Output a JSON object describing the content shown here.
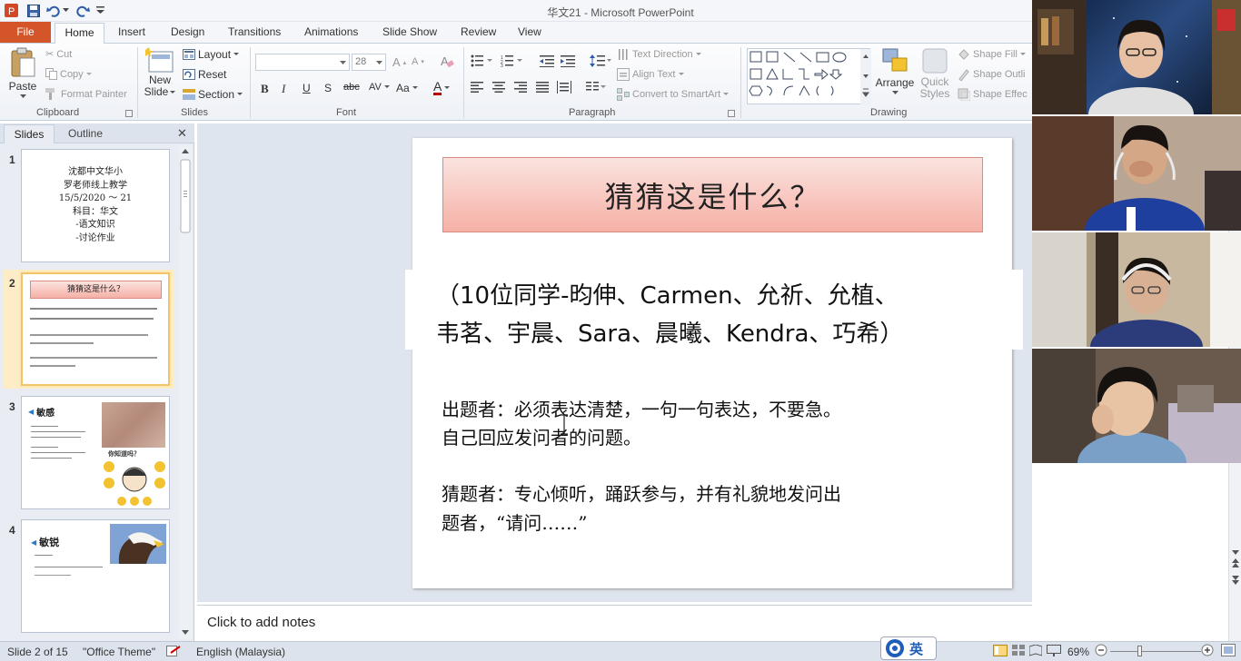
{
  "window": {
    "title": "华文21 - Microsoft PowerPoint"
  },
  "tabs": [
    "File",
    "Home",
    "Insert",
    "Design",
    "Transitions",
    "Animations",
    "Slide Show",
    "Review",
    "View"
  ],
  "ribbon": {
    "clipboard": {
      "label": "Clipboard",
      "paste": "Paste",
      "cut": "Cut",
      "copy": "Copy",
      "format_painter": "Format Painter"
    },
    "slides": {
      "label": "Slides",
      "new_slide_1": "New",
      "new_slide_2": "Slide",
      "layout": "Layout",
      "reset": "Reset",
      "section": "Section"
    },
    "font": {
      "label": "Font",
      "size": "28"
    },
    "paragraph": {
      "label": "Paragraph",
      "text_direction": "Text Direction",
      "align_text": "Align Text",
      "convert_smartart": "Convert to SmartArt"
    },
    "drawing": {
      "label": "Drawing",
      "arrange": "Arrange",
      "quick_1": "Quick",
      "quick_2": "Styles",
      "shape_fill": "Shape Fill",
      "shape_outline": "Shape Outli",
      "shape_effects": "Shape Effec"
    }
  },
  "left_pane": {
    "tab_slides": "Slides",
    "tab_outline": "Outline",
    "thumbnails": [
      {
        "num": "1",
        "lines": [
          "沈都中文华小",
          "罗老师线上教学",
          "15/5/2020 ～ 21",
          "科目：华文",
          "-语文知识",
          "-讨论作业"
        ]
      },
      {
        "num": "2",
        "title": "猜猜这是什么？"
      },
      {
        "num": "3",
        "word": "敏感",
        "callout": "你知道吗？"
      },
      {
        "num": "4",
        "word": "敏锐"
      }
    ]
  },
  "slide": {
    "title": "猜猜这是什么？",
    "names_line1": "（10位同学-昀伸、Carmen、允祈、允植、",
    "names_line2": "韦茗、宇晨、Sara、晨曦、Kendra、巧希）",
    "body": [
      "出题者：必须表达清楚，一句一句表达，不要急。",
      "自己回应发问者的问题。",
      "猜题者：专心倾听，踊跃参与，并有礼貌地发问出",
      "题者，“请问……”"
    ]
  },
  "notes": {
    "placeholder": "Click to add notes"
  },
  "status": {
    "slide_info": "Slide 2 of 15",
    "theme": "\"Office Theme\"",
    "language": "English (Malaysia)",
    "zoom": "69%",
    "ime": "英"
  },
  "colors": {
    "file_tab": "#d5552a",
    "title_box_top": "#fbe3df",
    "title_box_bottom": "#f5b0a6"
  }
}
